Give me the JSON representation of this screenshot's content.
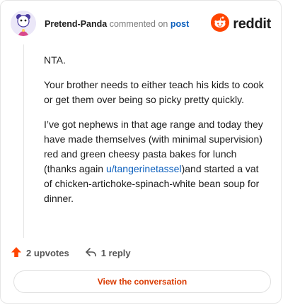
{
  "header": {
    "username": "Pretend-Panda",
    "commented_on": "commented on",
    "post_link": "post",
    "logo_text": "reddit"
  },
  "comment": {
    "p1": "NTA.",
    "p2": "Your brother needs to either teach his kids to cook or get them over being so picky pretty quickly.",
    "p3_before": "I’ve got nephews in that age range and today they have made themselves (with minimal supervision) red and green cheesy pasta bakes for lunch (thanks again ",
    "p3_link": "u/tangerinetassel",
    "p3_after": ")and started a vat of chicken-artichoke-spinach-white bean soup for dinner."
  },
  "actions": {
    "upvotes": "2 upvotes",
    "replies": "1 reply"
  },
  "cta": {
    "label": "View the conversation"
  },
  "colors": {
    "accent": "#ff4500",
    "link": "#0b5fbd",
    "cta_text": "#d93a00"
  },
  "icons": [
    "avatar",
    "reddit-logo-icon",
    "upvote-icon",
    "reply-icon"
  ]
}
